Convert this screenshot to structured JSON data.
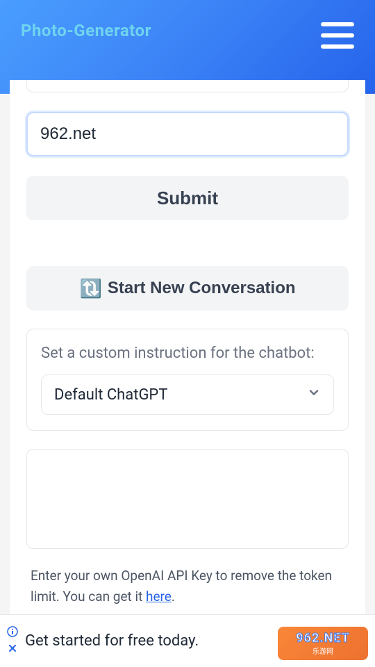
{
  "header": {
    "logo": "Photo-Generator"
  },
  "input": {
    "value": "962.net"
  },
  "buttons": {
    "submit": "Submit",
    "new_conversation": "Start New Conversation"
  },
  "instruction": {
    "label": "Set a custom instruction for the chatbot:",
    "selected": "Default ChatGPT"
  },
  "info": {
    "text_prefix": "Enter your own OpenAI API Key to remove the token limit. You can get it ",
    "link_text": "here",
    "text_suffix": "."
  },
  "ad": {
    "text": "Get started for free today."
  },
  "watermark": {
    "main": "962.NET",
    "sub": "乐游网"
  }
}
